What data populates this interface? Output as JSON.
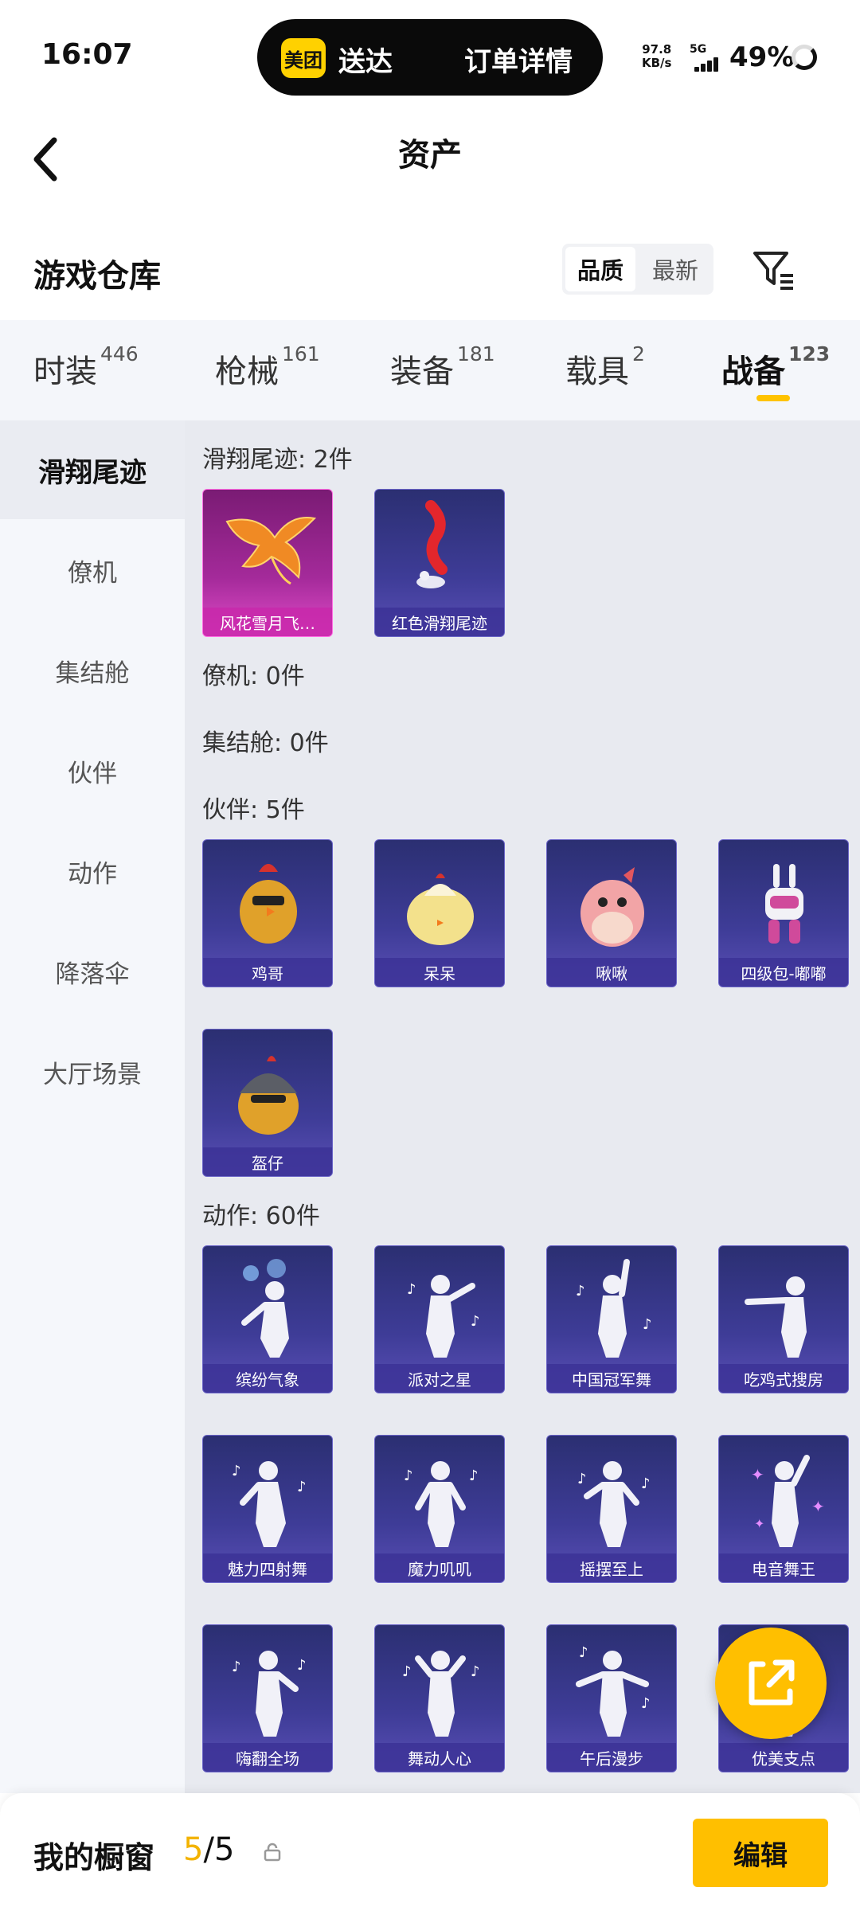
{
  "status_bar": {
    "time": "16:07",
    "pill_logo": "美团",
    "pill_left": "送达",
    "pill_right": "订单详情",
    "net_speed_value": "97.8",
    "net_speed_unit": "KB/s",
    "network": "5G",
    "battery": "49%"
  },
  "header": {
    "title": "资产",
    "back_icon": "chevron-left-icon"
  },
  "warehouse": {
    "title": "游戏仓库",
    "sort_options": [
      "品质",
      "最新"
    ],
    "filter_icon": "filter-icon"
  },
  "tabs": [
    {
      "label": "时装",
      "count": "446"
    },
    {
      "label": "枪械",
      "count": "161"
    },
    {
      "label": "装备",
      "count": "181"
    },
    {
      "label": "载具",
      "count": "2"
    },
    {
      "label": "战备",
      "count": "123"
    }
  ],
  "sidebar": [
    "滑翔尾迹",
    "僚机",
    "集结舱",
    "伙伴",
    "动作",
    "降落伞",
    "大厅场景"
  ],
  "sections": [
    {
      "title": "滑翔尾迹: 2件",
      "items": [
        "风花雪月飞…",
        "红色滑翔尾迹"
      ]
    },
    {
      "title": "僚机: 0件",
      "items": []
    },
    {
      "title": "集结舱: 0件",
      "items": []
    },
    {
      "title": "伙伴: 5件",
      "items": [
        "鸡哥",
        "呆呆",
        "啾啾",
        "四级包-嘟嘟",
        "盔仔"
      ]
    },
    {
      "title": "动作: 60件",
      "items": [
        "缤纷气象",
        "派对之星",
        "中国冠军舞",
        "吃鸡式搜房",
        "魅力四射舞",
        "魔力叽叽",
        "摇摆至上",
        "电音舞王",
        "嗨翻全场",
        "舞动人心",
        "午后漫步",
        "优美支点"
      ]
    }
  ],
  "fab_icon": "share-icon",
  "bottom": {
    "title": "我的橱窗",
    "count_current": "5",
    "count_sep": "/",
    "count_total": "5",
    "lock_icon": "lock-icon",
    "edit": "编辑"
  },
  "colors": {
    "accent": "#ffbf00",
    "card": "#3e3c97",
    "card_pink": "#a42a9a"
  }
}
